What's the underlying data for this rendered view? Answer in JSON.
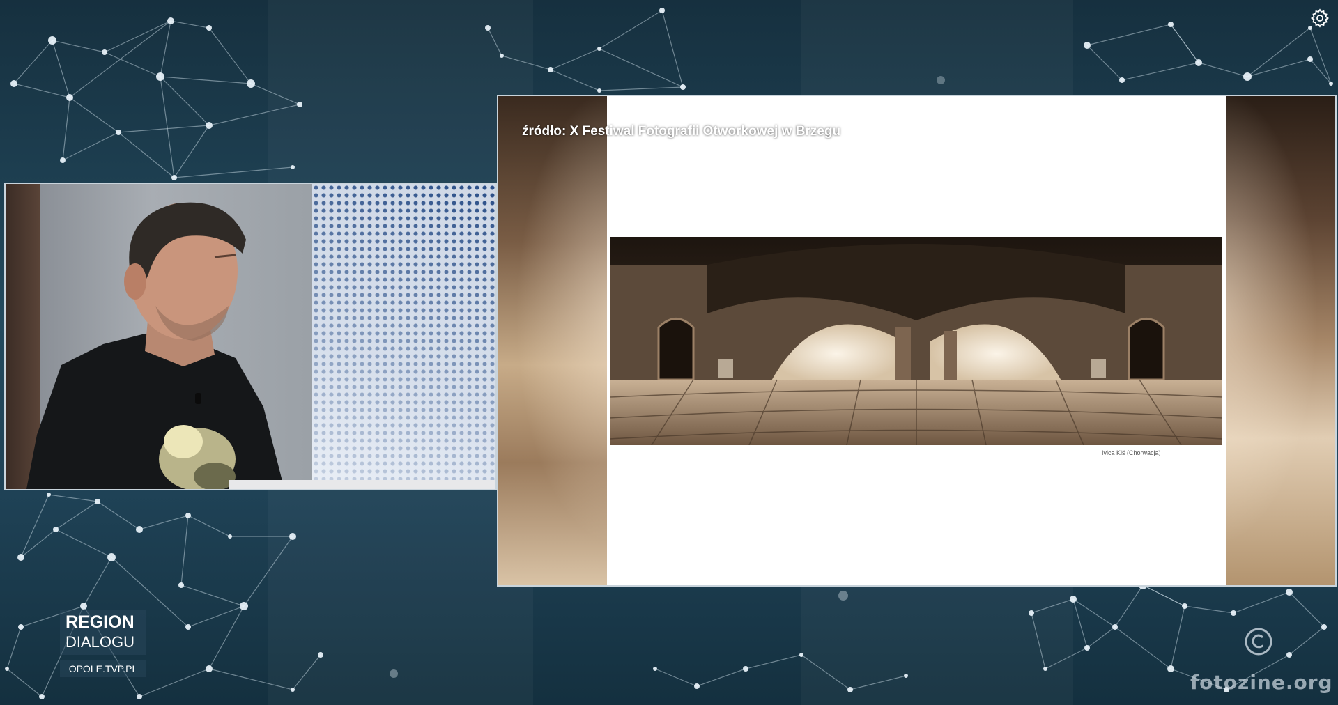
{
  "slide": {
    "source_caption": "źródło: X Festiwal Fotografii Otworkowej w Brzegu",
    "photo_credit": "Ivica Kiš (Chorwacja)"
  },
  "logo": {
    "line1": "REGION",
    "line2": "DIALOGU",
    "url": "OPOLE.TVP.PL"
  },
  "watermark": {
    "text": "fotozine.org"
  },
  "icons": {
    "settings": "gear-icon",
    "copyright": "copyright-icon"
  },
  "colors": {
    "background": "#1d3a4c",
    "panel_border": "#c9d4dc",
    "sepia": "#7a5d45",
    "screen_dots": "#274c86"
  }
}
